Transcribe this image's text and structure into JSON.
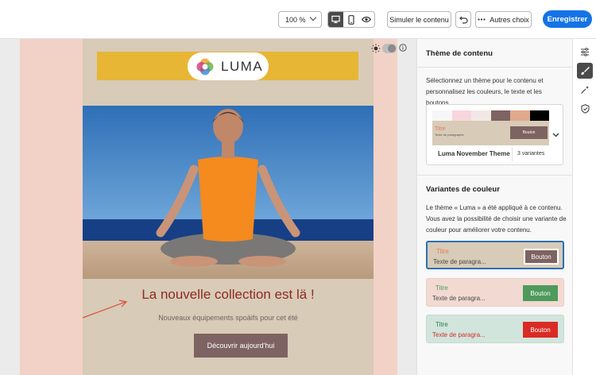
{
  "toolbar": {
    "zoom_value": "100 %",
    "simulate_label": "Simuler le contenu",
    "more_label": "Autres choix",
    "save_label": "Enregistrer"
  },
  "email": {
    "logo_text": "LUMA",
    "headline": "La nouvelle collection est lä !",
    "subline": "Nouveaux équipements spoäifs pour cet été",
    "cta_label": "Découvrir aujourd'hui"
  },
  "panel": {
    "title": "Thème de contenu",
    "description": "Sélectionnez un thème pour le contenu et personnalisez les couleurs, le texte et les boutons.",
    "theme_card": {
      "preview_title": "Titre",
      "preview_text": "Texte de paragraphe",
      "preview_button": "Bouton",
      "theme_name": "Luma November Theme",
      "variants_count": "3 variantes",
      "swatches": [
        "#f7f7f7",
        "#f9d6dc",
        "#f2e8e6",
        "#7d6361",
        "#e0a98c",
        "#000000"
      ]
    },
    "variants_title": "Variantes de couleur",
    "variants_description": "Le thème « Luma » a été appliqué à ce contenu. Vous avez la possibilité de choisir une variante de couleur pour améliorer votre contenu.",
    "variants": [
      {
        "title": "Titre",
        "paragraph": "Texte de paragra...",
        "button": "Bouton",
        "bg": "#d8cbb7",
        "title_color": "#e07d57",
        "text_color": "#4a4a4a",
        "button_color": "#7d6361"
      },
      {
        "title": "Titre",
        "paragraph": "Texte de paragra...",
        "button": "Bouton",
        "bg": "#f2d9d2",
        "title_color": "#4e9a5b",
        "text_color": "#4a4a4a",
        "button_color": "#4e9a5b"
      },
      {
        "title": "Titre",
        "paragraph": "Texte de paragra...",
        "button": "Bouton",
        "bg": "#d1e5dc",
        "title_color": "#2a7d4c",
        "text_color": "#d0312d",
        "button_color": "#d92b25"
      }
    ]
  },
  "colors": {
    "accent": "#1473e6",
    "email_bg": "#f2d2c6",
    "email_content_bg": "#d8cbb7",
    "logo_bar": "#e7b635",
    "headline": "#8f2a21",
    "cta": "#7d6361"
  }
}
